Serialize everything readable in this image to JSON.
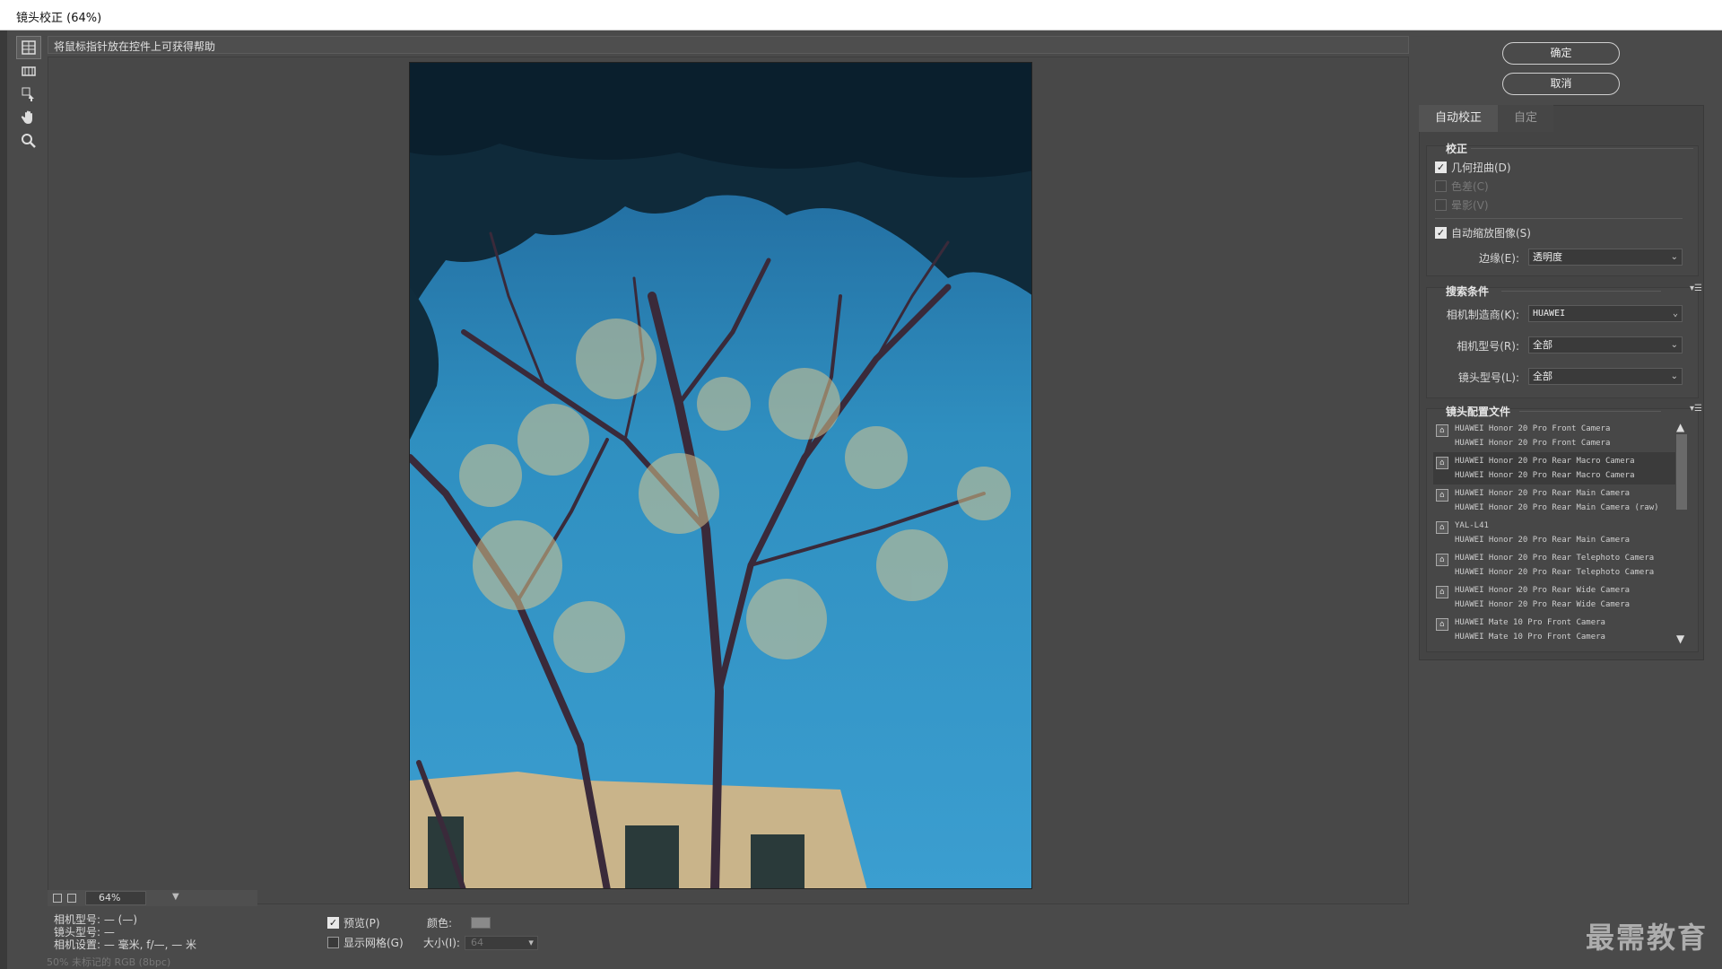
{
  "window": {
    "title": "镜头校正 (64%)"
  },
  "help": {
    "text": "将鼠标指针放在控件上可获得帮助"
  },
  "buttons": {
    "ok": "确定",
    "cancel": "取消"
  },
  "tabs": [
    {
      "label": "自动校正"
    },
    {
      "label": "自定"
    }
  ],
  "correction": {
    "title": "校正",
    "geometric": "几何扭曲(D)",
    "chromatic": "色差(C)",
    "vignette": "晕影(V)",
    "autoscale": "自动缩放图像(S)",
    "edge_label": "边缘(E):",
    "edge_value": "透明度"
  },
  "search": {
    "title": "搜索条件",
    "maker_label": "相机制造商(K):",
    "maker_value": "HUAWEI",
    "model_label": "相机型号(R):",
    "model_value": "全部",
    "lens_label": "镜头型号(L):",
    "lens_value": "全部"
  },
  "profiles": {
    "title": "镜头配置文件",
    "items": [
      {
        "line1": "HUAWEI Honor 20 Pro Front Camera",
        "line2": "HUAWEI Honor 20 Pro Front Camera"
      },
      {
        "line1": "HUAWEI Honor 20 Pro Rear Macro Camera",
        "line2": "HUAWEI Honor 20 Pro Rear Macro Camera"
      },
      {
        "line1": "HUAWEI Honor 20 Pro Rear Main Camera",
        "line2": "HUAWEI Honor 20 Pro Rear Main Camera (raw)"
      },
      {
        "line1": "YAL-L41",
        "line2": "HUAWEI Honor 20 Pro Rear Main Camera"
      },
      {
        "line1": "HUAWEI Honor 20 Pro Rear Telephoto Camera",
        "line2": "HUAWEI Honor 20 Pro Rear Telephoto Camera"
      },
      {
        "line1": "HUAWEI Honor 20 Pro Rear Wide Camera",
        "line2": "HUAWEI Honor 20 Pro Rear Wide Camera"
      },
      {
        "line1": "HUAWEI Mate 10 Pro Front Camera",
        "line2": "HUAWEI Mate 10 Pro Front Camera"
      }
    ]
  },
  "zoom": {
    "value": "64%"
  },
  "info": {
    "camera_model": "相机型号: — (—)",
    "lens_model": "镜头型号: —",
    "camera_settings": "相机设置: — 毫米, f/—, — 米"
  },
  "options": {
    "preview": "预览(P)",
    "show_grid": "显示网格(G)",
    "color_label": "颜色:",
    "size_label": "大小(I):",
    "size_value": "64"
  },
  "status": {
    "text": "50%     未标记的 RGB (8bpc)"
  },
  "watermark": "最需教育",
  "colors": {
    "sky": "#2f8fc0",
    "foliage": "#0f2a3a",
    "panel": "#444444"
  }
}
